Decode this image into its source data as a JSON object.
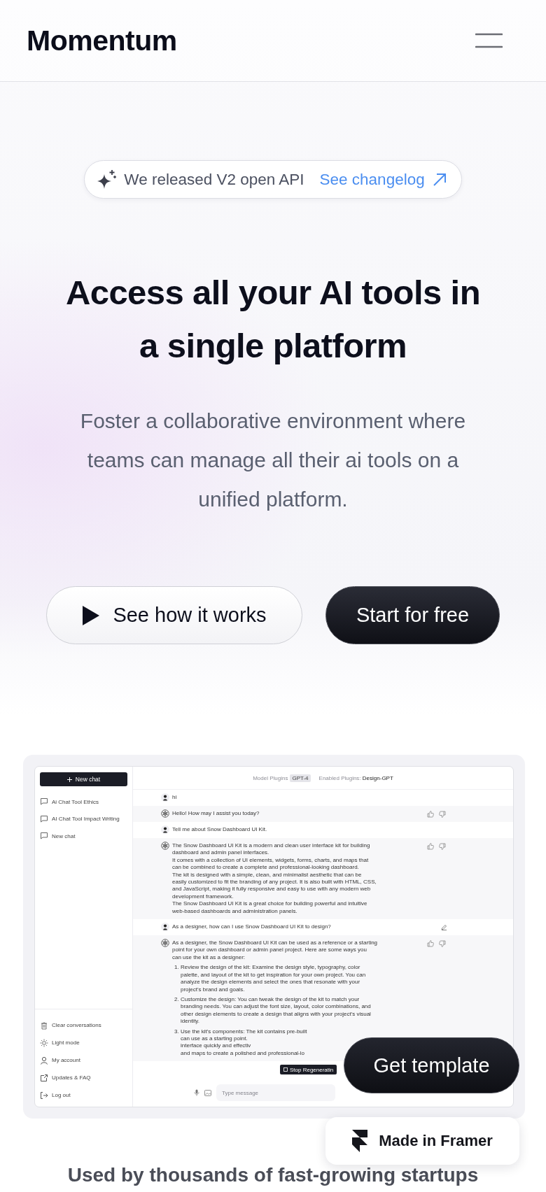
{
  "header": {
    "logo": "Momentum"
  },
  "hero": {
    "announcement": {
      "text": "We released V2 open API",
      "link": "See changelog"
    },
    "title": "Access all your AI tools in a single platform",
    "subtitle": "Foster a collaborative environment where teams can manage all their ai tools on a unified platform.",
    "buttons": [
      {
        "label": "See how it works",
        "kind": "secondary"
      },
      {
        "label": "Start for free",
        "kind": "primary"
      }
    ]
  },
  "preview": {
    "sidebar": {
      "new_chat": "New chat",
      "conversations": [
        "Ai Chat Tool Ethics",
        "AI Chat Tool Impact Writing",
        "New chat"
      ],
      "menu": [
        "Clear conversations",
        "Light mode",
        "My account",
        "Updates & FAQ",
        "Log out"
      ]
    },
    "topbar": {
      "model_label": "Model Plugins",
      "model": "GPT-4",
      "plugins": "Enabled Plugins: **Design-GPT**"
    },
    "messages": [
      {
        "kind": "user",
        "editable": false,
        "text": "hi"
      },
      {
        "kind": "assistant",
        "editable": false,
        "text": "Hello! How may I assist you today?"
      },
      {
        "kind": "user",
        "editable": false,
        "text": "Tell me about Snow Dashboard UI Kit."
      },
      {
        "kind": "assistant",
        "editable": false,
        "text": "The Snow Dashboard UI Kit is a modern and clean user interface kit for building\ndashboard and admin panel interfaces.\nIt comes with a collection of UI elements, widgets, forms, charts, and maps that\ncan be combined to create a complete and professional-looking dashboard.\nThe kit is designed with a simple, clean, and minimalist aesthetic that can be\neasily customized to fit the branding of any project. It is also built with HTML, CSS,\nand JavaScript, making it fully responsive and easy to use with any modern web\ndevelopment framework.\nThe Snow Dashboard UI Kit is a great choice for building powerful and intuitive\nweb-based dashboards and administration panels."
      },
      {
        "kind": "user",
        "editable": true,
        "text": "As a designer, how can I use Snow Dashboard UI Kit to design?"
      },
      {
        "kind": "assistant",
        "editable": false,
        "text": "As a designer, the Snow Dashboard UI Kit can be used as a reference or a starting\npoint for your own dashboard or admin panel project. Here are some ways you\ncan use the kit as a designer:",
        "list": [
          {
            "number": "1.",
            "text": "Review the design of the kit: Examine the design style, typography, color\npalette, and layout of the kit to get inspiration for your own project. You can\nanalyze the design elements and select the ones that resonate with your\nproject's brand and goals."
          },
          {
            "number": "2.",
            "text": "Customize the design: You can tweak the design of the kit to match your\nbranding needs. You can adjust the font size, layout, color combinations, and\nother design elements to create a design that aligns with your project's visual\nidentity."
          },
          {
            "number": "3.",
            "text": "Use the kit's components: The kit contains pre-built\ncan use as a starting point.\ninterface quickly and effectiv\nand maps to create a polished and professional-lo"
          }
        ]
      }
    ],
    "stop_button": "Stop Regeneratin",
    "composer": {
      "placeholder": "Type message"
    }
  },
  "floating": {
    "get_template": "Get template",
    "made_in": "Made in Framer"
  },
  "footer_heading": "Used by thousands of fast-growing startups"
}
